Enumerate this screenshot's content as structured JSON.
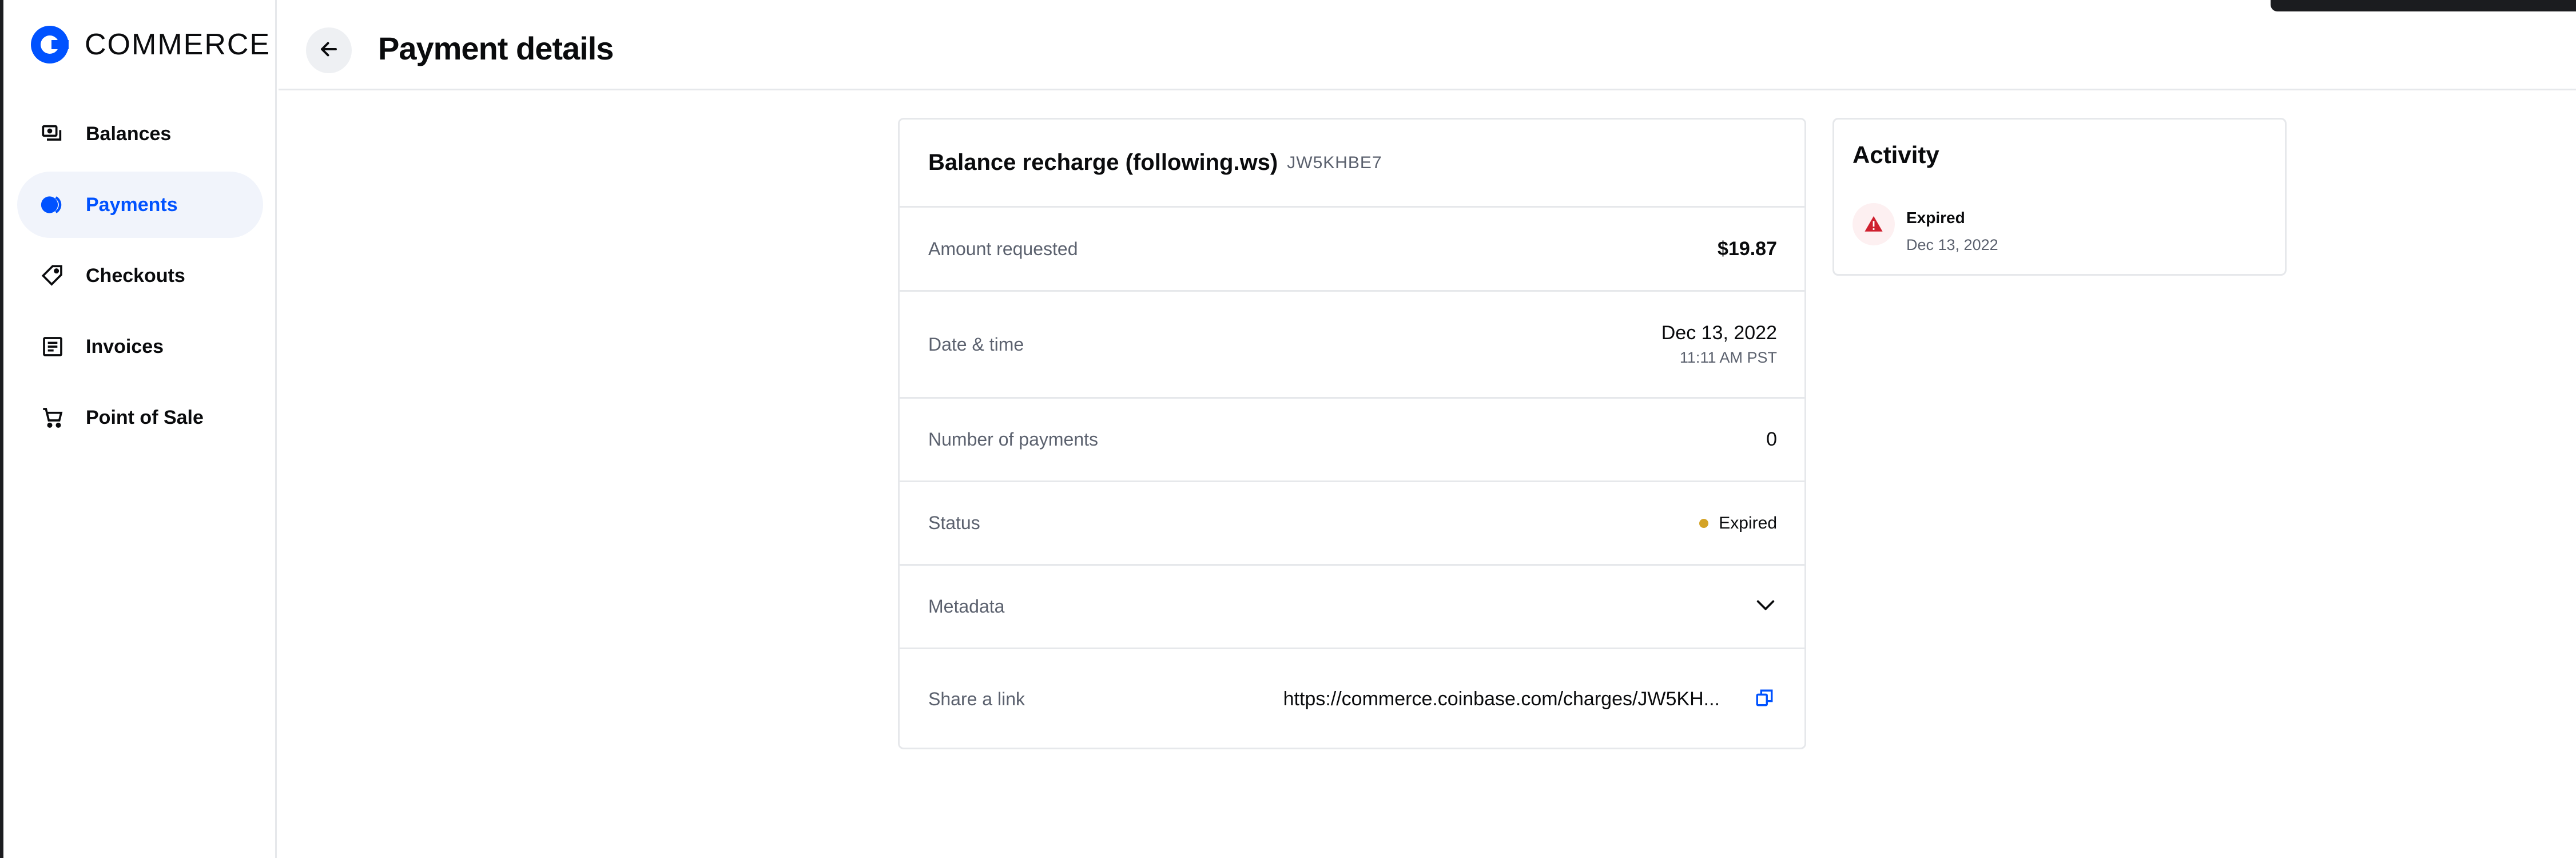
{
  "brand": {
    "name": "COMMERCE",
    "logo_color": "#0052ff"
  },
  "sidebar": {
    "items": [
      {
        "label": "Balances",
        "icon": "balances-icon",
        "active": false
      },
      {
        "label": "Payments",
        "icon": "payments-icon",
        "active": true
      },
      {
        "label": "Checkouts",
        "icon": "tag-icon",
        "active": false
      },
      {
        "label": "Invoices",
        "icon": "invoice-icon",
        "active": false
      },
      {
        "label": "Point of Sale",
        "icon": "cart-icon",
        "active": false
      }
    ]
  },
  "header": {
    "title": "Payment details",
    "back_icon": "arrow-left-icon"
  },
  "payment": {
    "title": "Balance recharge (following.ws)",
    "code": "JW5KHBE7",
    "amount_label": "Amount requested",
    "amount_value": "$19.87",
    "datetime_label": "Date & time",
    "date_value": "Dec 13, 2022",
    "time_value": "11:11 AM PST",
    "num_payments_label": "Number of payments",
    "num_payments_value": "0",
    "status_label": "Status",
    "status_value": "Expired",
    "status_color": "#d4a326",
    "metadata_label": "Metadata",
    "share_label": "Share a link",
    "share_value": "https://commerce.coinbase.com/charges/JW5KH..."
  },
  "activity": {
    "title": "Activity",
    "events": [
      {
        "status": "Expired",
        "date": "Dec 13, 2022",
        "icon": "warning-icon",
        "color": "#cf202f"
      }
    ]
  },
  "colors": {
    "accent": "#0052ff",
    "active_bg": "#f1f4fb",
    "border": "#e6e8eb",
    "muted_text": "#5b616e"
  }
}
